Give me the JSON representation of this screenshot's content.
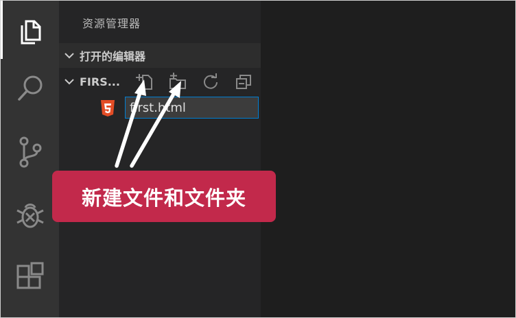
{
  "activity_bar": {
    "items": [
      {
        "icon": "files-icon",
        "active": true
      },
      {
        "icon": "search-icon",
        "active": false
      },
      {
        "icon": "source-control-icon",
        "active": false
      },
      {
        "icon": "debug-icon",
        "active": false
      },
      {
        "icon": "extensions-icon",
        "active": false
      }
    ]
  },
  "sidebar": {
    "title": "资源管理器",
    "open_editors_label": "打开的编辑器",
    "folder_label": "FIRS...",
    "folder_actions": [
      "new-file-icon",
      "new-folder-icon",
      "refresh-icon",
      "collapse-all-icon"
    ],
    "new_file": {
      "icon": "html5-icon",
      "value": "first.html"
    }
  },
  "annotation": {
    "callout_text": "新建文件和文件夹"
  },
  "colors": {
    "activity_bar": "#333333",
    "sidebar": "#252526",
    "editor": "#1e1e1e",
    "input_border": "#007fd4",
    "html_icon": "#e44d26",
    "callout": "#c2294b"
  }
}
